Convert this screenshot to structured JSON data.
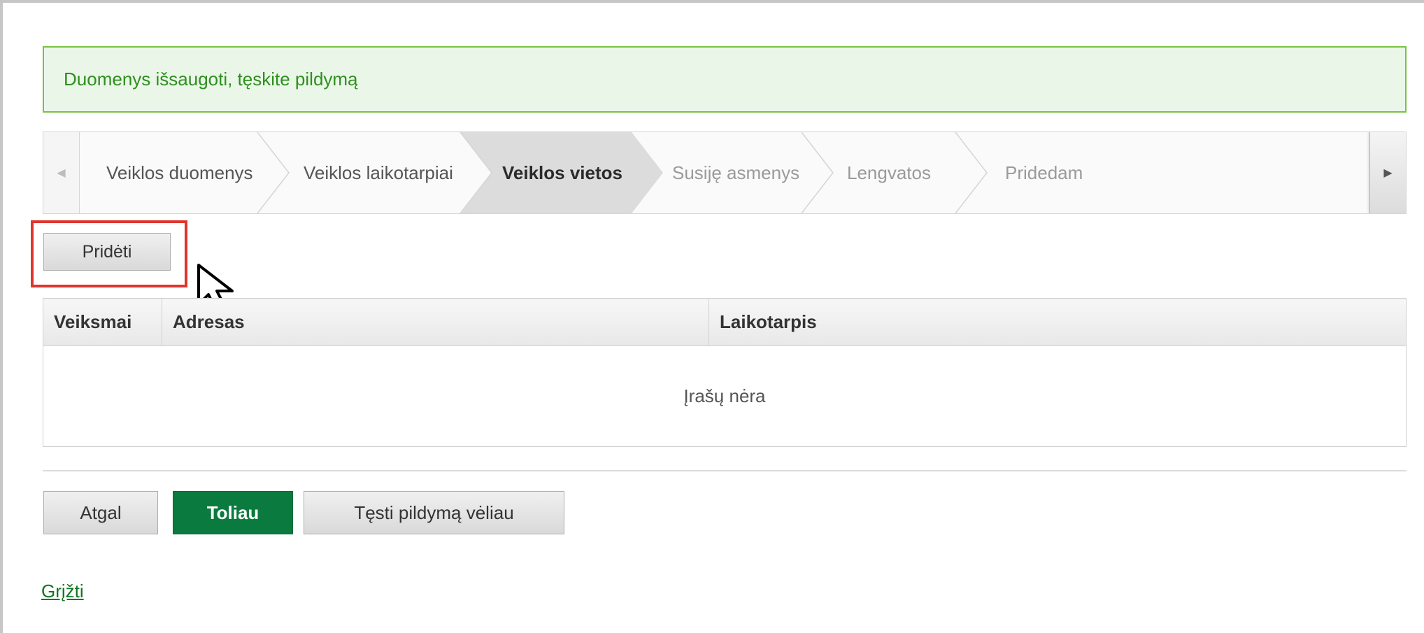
{
  "alert": {
    "message": "Duomenys išsaugoti, tęskite pildymą"
  },
  "wizard": {
    "prev_icon": "triangle-left-icon",
    "next_icon": "triangle-right-icon",
    "steps": [
      {
        "label": "Veiklos duomenys",
        "state": "done"
      },
      {
        "label": "Veiklos laikotarpiai",
        "state": "done"
      },
      {
        "label": "Veiklos vietos",
        "state": "active"
      },
      {
        "label": "Susiję asmenys",
        "state": "future"
      },
      {
        "label": "Lengvatos",
        "state": "future"
      },
      {
        "label": "Pridedam",
        "state": "future"
      }
    ]
  },
  "toolbar": {
    "add_label": "Pridėti"
  },
  "table": {
    "columns": [
      "Veiksmai",
      "Adresas",
      "Laikotarpis"
    ],
    "empty_text": "Įrašų nėra"
  },
  "footer": {
    "back_label": "Atgal",
    "next_label": "Toliau",
    "later_label": "Tęsti pildymą vėliau",
    "return_link": "Grįžti"
  },
  "colors": {
    "alert_bg": "#eaf7e8",
    "alert_border": "#7ac143",
    "primary_button": "#0b7a3e",
    "highlight": "#e0342d",
    "link": "#13751f"
  },
  "annotations": {
    "cursor_icon": "mouse-pointer-icon"
  }
}
